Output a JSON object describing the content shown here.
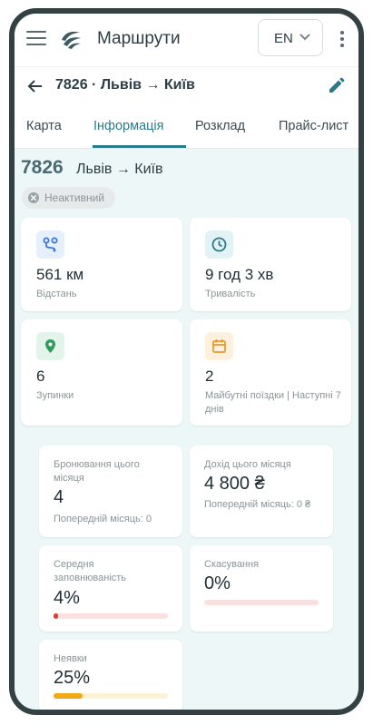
{
  "app": {
    "title": "Маршрути",
    "language": "EN"
  },
  "route": {
    "header_title": "7826 · Львів → Київ",
    "number": "7826",
    "cities": "Львів → Київ",
    "status": "Неактивний"
  },
  "tabs": [
    {
      "label": "Карта",
      "active": false
    },
    {
      "label": "Інформація",
      "active": true
    },
    {
      "label": "Розклад",
      "active": false
    },
    {
      "label": "Прайс-лист",
      "active": false
    }
  ],
  "stats": {
    "distance": {
      "value": "561 км",
      "label": "Відстань",
      "icon": "route-icon",
      "color": "#3b78d8",
      "bg": "#e6f0fb"
    },
    "duration": {
      "value": "9 год 3 хв",
      "label": "Тривалість",
      "icon": "clock-icon",
      "color": "#2b7a8c",
      "bg": "#e3f3f5"
    },
    "stops": {
      "value": "6",
      "label": "Зупинки",
      "icon": "location-pin-icon",
      "color": "#2e9e5b",
      "bg": "#e3f5ea"
    },
    "upcoming": {
      "value": "2",
      "label": "Майбутні поїздки | Наступні 7 днів",
      "icon": "calendar-icon",
      "color": "#e89a2c",
      "bg": "#fdf0df"
    }
  },
  "metrics": {
    "bookings": {
      "label": "Бронювання цього місяця",
      "value": "4",
      "sub": "Попередній місяць: 0"
    },
    "revenue": {
      "label": "Дохід цього місяця",
      "value": "4 800 ₴",
      "sub": "Попередній місяць: 0 ₴"
    },
    "occupancy": {
      "label": "Середня заповнюваність",
      "value": "4%",
      "fill": 0.04,
      "fill_color": "#e53935",
      "track_color": "#fbe0e0"
    },
    "cancellations": {
      "label": "Скасування",
      "value": "0%",
      "fill": 0.0,
      "fill_color": "#e53935",
      "track_color": "#fbe0e0"
    },
    "noshows": {
      "label": "Неявки",
      "value": "25%",
      "fill": 0.25,
      "fill_color": "#f2a713",
      "track_color": "#fdf1d6"
    }
  }
}
